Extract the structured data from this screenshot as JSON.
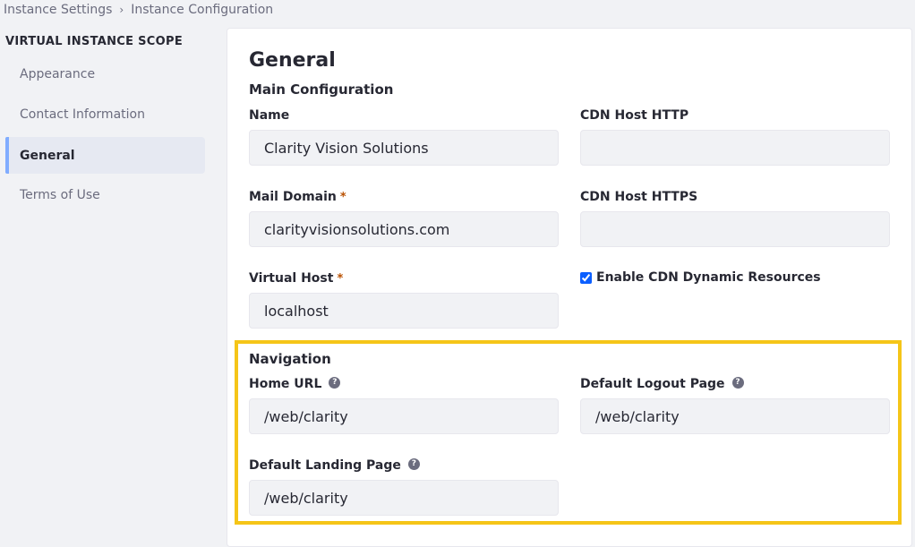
{
  "breadcrumb": {
    "items": [
      "Instance Settings",
      "Instance Configuration"
    ],
    "separator_icon": "chevron-right-icon"
  },
  "sidebar": {
    "heading": "VIRTUAL INSTANCE SCOPE",
    "items": [
      {
        "label": "Appearance",
        "active": false
      },
      {
        "label": "Contact Information",
        "active": false
      },
      {
        "label": "General",
        "active": true
      },
      {
        "label": "Terms of Use",
        "active": false
      }
    ]
  },
  "main": {
    "title": "General",
    "main_configuration": {
      "heading": "Main Configuration",
      "name": {
        "label": "Name",
        "value": "Clarity Vision Solutions"
      },
      "mail_domain": {
        "label": "Mail Domain",
        "required_mark": "*",
        "value": "clarityvisionsolutions.com"
      },
      "virtual_host": {
        "label": "Virtual Host",
        "required_mark": "*",
        "value": "localhost"
      },
      "cdn_host_http": {
        "label": "CDN Host HTTP",
        "value": ""
      },
      "cdn_host_https": {
        "label": "CDN Host HTTPS",
        "value": ""
      },
      "enable_cdn_dynamic_resources": {
        "label": "Enable CDN Dynamic Resources",
        "checked": true
      }
    },
    "navigation": {
      "heading": "Navigation",
      "home_url": {
        "label": "Home URL",
        "help_icon": "?",
        "value": "/web/clarity"
      },
      "default_logout_page": {
        "label": "Default Logout Page",
        "help_icon": "?",
        "value": "/web/clarity"
      },
      "default_landing_page": {
        "label": "Default Landing Page",
        "help_icon": "?",
        "value": "/web/clarity"
      }
    }
  },
  "colors": {
    "highlight_border": "#f5c518",
    "active_nav_accent": "#80acff",
    "required_mark": "#b95000",
    "checkbox_accent": "#0b5fff"
  }
}
